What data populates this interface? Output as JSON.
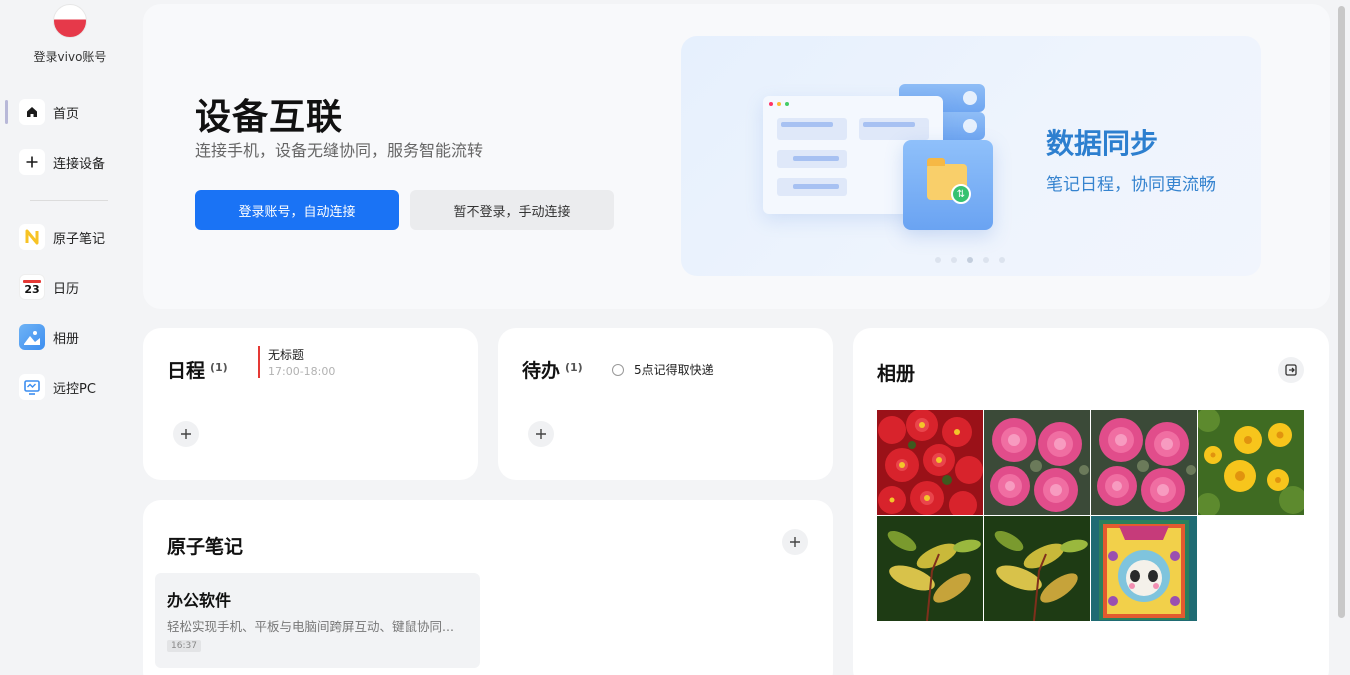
{
  "sidebar": {
    "account_label": "登录vivo账号",
    "items": [
      {
        "label": "首页",
        "icon": "home-icon"
      },
      {
        "label": "连接设备",
        "icon": "plus-icon"
      },
      {
        "label": "原子笔记",
        "icon": "atom-notes-icon"
      },
      {
        "label": "日历",
        "icon": "calendar-icon",
        "day": "23"
      },
      {
        "label": "相册",
        "icon": "album-icon"
      },
      {
        "label": "远控PC",
        "icon": "remote-pc-icon"
      }
    ]
  },
  "hero": {
    "title": "设备互联",
    "subtitle": "连接手机，设备无缝协同，服务智能流转",
    "primary_button": "登录账号，自动连接",
    "secondary_button": "暂不登录，手动连接",
    "banner": {
      "title": "数据同步",
      "subtitle": "笔记日程，协同更流畅",
      "active_dot": 3,
      "dot_count": 5
    }
  },
  "schedule": {
    "title": "日程",
    "count": "(1)",
    "event_title": "无标题",
    "event_time": "17:00-18:00"
  },
  "todo": {
    "title": "待办",
    "count": "(1)",
    "item": "5点记得取快递"
  },
  "notes": {
    "title": "原子笔记",
    "note_title": "办公软件",
    "note_body": "轻松实现手机、平板与电脑间跨屏互动、键鼠协同...",
    "note_time": "16:37"
  },
  "album": {
    "title": "相册",
    "photos": [
      "red-begonia",
      "pink-rose",
      "pink-rose",
      "yellow-coreopsis",
      "green-leaves",
      "green-leaves",
      "colorful-painting"
    ]
  },
  "colors": {
    "accent": "#1a73f5",
    "banner_text": "#2d7fcf",
    "event_bar": "#e53935"
  }
}
